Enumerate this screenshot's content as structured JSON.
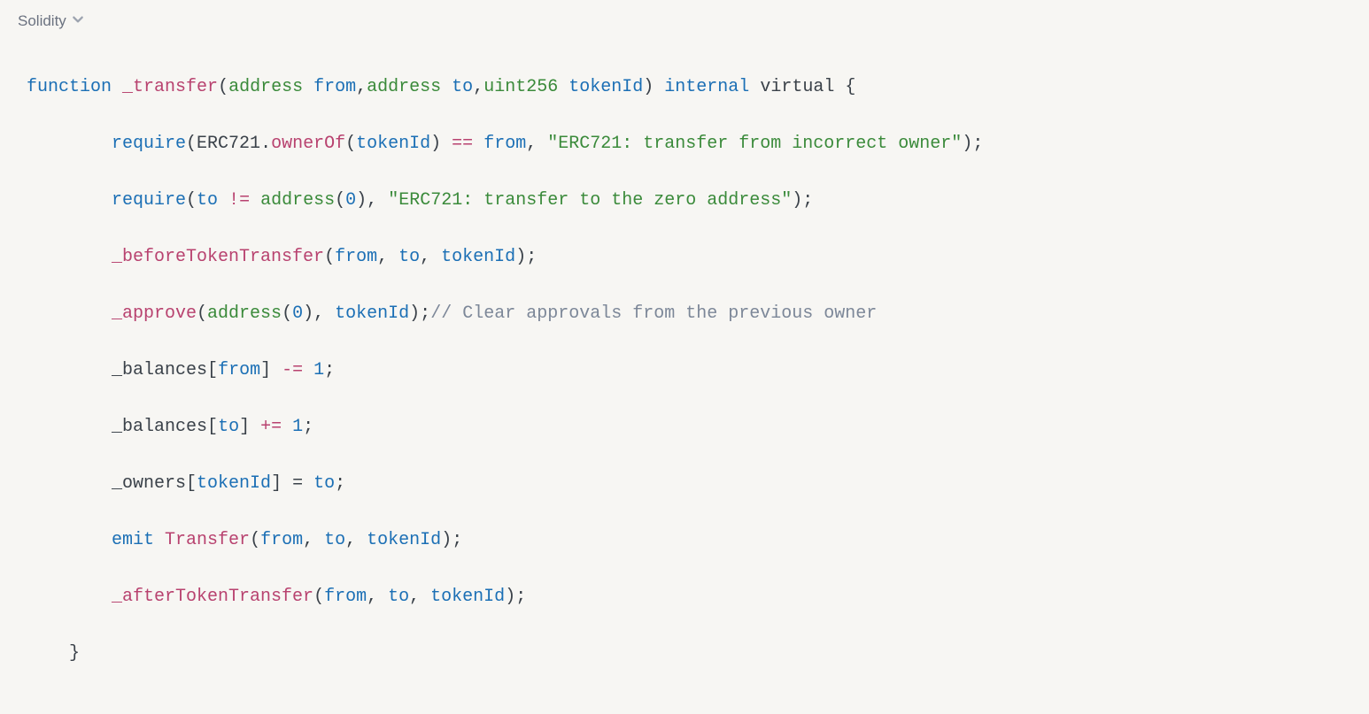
{
  "language_label": "Solidity",
  "code": {
    "line1": {
      "kw_function": "function",
      "fn_transfer": "_transfer",
      "paren_open": "(",
      "type_address1": "address",
      "ident_from": "from",
      "comma1": ",",
      "type_address2": "address",
      "ident_to": "to",
      "comma2": ",",
      "type_uint": "uint256",
      "ident_tokenId": "tokenId",
      "paren_close": ")",
      "kw_internal": "internal",
      "kw_virtual": "virtual",
      "brace_open": "{"
    },
    "line2": {
      "fn_require": "require",
      "paren_open": "(",
      "struct_erc721": "ERC721",
      "dot": ".",
      "fn_ownerOf": "ownerOf",
      "paren_open2": "(",
      "ident_tokenId": "tokenId",
      "paren_close2": ")",
      "op_eq": "==",
      "ident_from": "from",
      "comma": ",",
      "str": "\"ERC721: transfer from incorrect owner\"",
      "paren_close": ")",
      "semi": ";"
    },
    "line3": {
      "fn_require": "require",
      "paren_open": "(",
      "ident_to": "to",
      "op_neq": "!=",
      "type_address": "address",
      "paren_open2": "(",
      "num_zero": "0",
      "paren_close2": ")",
      "comma": ",",
      "str": "\"ERC721: transfer to the zero address\"",
      "paren_close": ")",
      "semi": ";"
    },
    "line4": {
      "fn_before": "_beforeTokenTransfer",
      "paren_open": "(",
      "ident_from": "from",
      "comma1": ",",
      "ident_to": "to",
      "comma2": ",",
      "ident_tokenId": "tokenId",
      "paren_close": ")",
      "semi": ";"
    },
    "line5": {
      "fn_approve": "_approve",
      "paren_open": "(",
      "type_address": "address",
      "paren_open2": "(",
      "num_zero": "0",
      "paren_close2": ")",
      "comma": ",",
      "ident_tokenId": "tokenId",
      "paren_close": ")",
      "semi": ";",
      "cmt": "// Clear approvals from the previous owner"
    },
    "line6": {
      "ident_balances": "_balances",
      "bracket_open": "[",
      "ident_from": "from",
      "bracket_close": "]",
      "op_minuseq": "-=",
      "num_one": "1",
      "semi": ";"
    },
    "line7": {
      "ident_balances": "_balances",
      "bracket_open": "[",
      "ident_to": "to",
      "bracket_close": "]",
      "op_pluseq": "+=",
      "num_one": "1",
      "semi": ";"
    },
    "line8": {
      "ident_owners": "_owners",
      "bracket_open": "[",
      "ident_tokenId": "tokenId",
      "bracket_close": "]",
      "op_assign": "=",
      "ident_to": "to",
      "semi": ";"
    },
    "line9": {
      "kw_emit": "emit",
      "fn_transfer_event": "Transfer",
      "paren_open": "(",
      "ident_from": "from",
      "comma1": ",",
      "ident_to": "to",
      "comma2": ",",
      "ident_tokenId": "tokenId",
      "paren_close": ")",
      "semi": ";"
    },
    "line10": {
      "fn_after": "_afterTokenTransfer",
      "paren_open": "(",
      "ident_from": "from",
      "comma1": ",",
      "ident_to": "to",
      "comma2": ",",
      "ident_tokenId": "tokenId",
      "paren_close": ")",
      "semi": ";"
    },
    "line11": {
      "brace_close": "}"
    }
  }
}
